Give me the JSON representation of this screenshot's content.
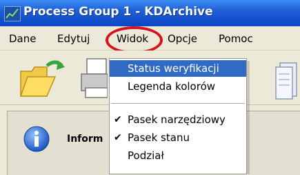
{
  "window": {
    "title": "Process Group 1 - KDArchive"
  },
  "menu": {
    "items": [
      {
        "label": "Dane"
      },
      {
        "label": "Edytuj"
      },
      {
        "label": "Widok"
      },
      {
        "label": "Opcje"
      },
      {
        "label": "Pomoc"
      }
    ],
    "highlighted": "Widok"
  },
  "dropdown": {
    "items": [
      {
        "label": "Status weryfikacji",
        "checked": false,
        "selected": true
      },
      {
        "label": "Legenda kolorów",
        "checked": false,
        "selected": false
      },
      {
        "label": "Pasek narzędziowy",
        "checked": true,
        "selected": false
      },
      {
        "label": "Pasek stanu",
        "checked": true,
        "selected": false
      },
      {
        "label": "Podział",
        "checked": false,
        "selected": false
      }
    ],
    "check_glyph": "✔"
  },
  "panel": {
    "label": "Inform"
  },
  "colors": {
    "title_bar": "#0b46c4",
    "highlight": "#316ac5",
    "annotation_circle": "#d8121c",
    "menu_bg": "#ece9d8"
  },
  "icons": [
    "app-logo-icon",
    "open-folder-icon",
    "printer-icon",
    "document-icon",
    "info-icon"
  ]
}
